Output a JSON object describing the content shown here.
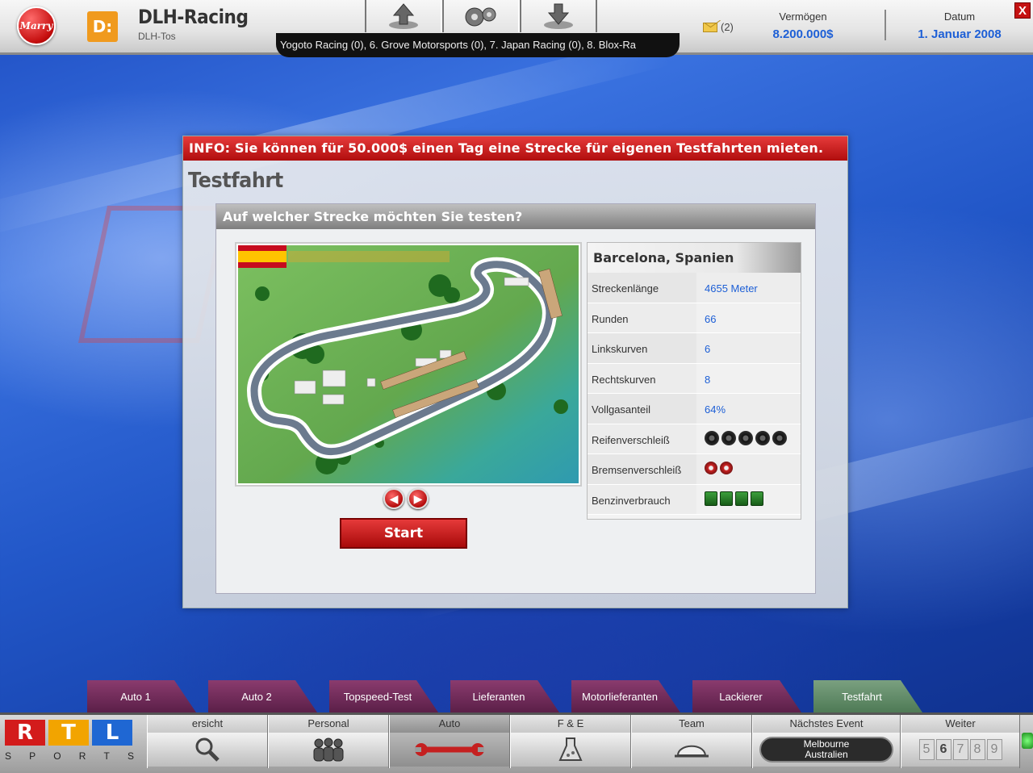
{
  "topbar": {
    "badge": "Marry",
    "team_logo": "D:",
    "team_name": "DLH-Racing",
    "team_owner": "DLH-Tos",
    "ticker": "Yogoto Racing (0),   6. Grove Motorsports (0),   7. Japan Racing (0),   8. Blox-Ra",
    "mail_count": "(2)",
    "vermoegen_label": "Vermögen",
    "vermoegen_value": "8.200.000$",
    "datum_label": "Datum",
    "datum_value": "1. Januar 2008",
    "close": "X"
  },
  "dialog": {
    "info": "INFO: Sie können für 50.000$ einen Tag eine Strecke für eigenen Testfahrten mieten.",
    "title": "Testfahrt",
    "panel_header": "Auf welcher Strecke möchten Sie testen?",
    "start_label": "Start",
    "track": {
      "name": "Barcelona, Spanien",
      "rows": [
        {
          "label": "Streckenlänge",
          "value": "4655 Meter"
        },
        {
          "label": "Runden",
          "value": "66"
        },
        {
          "label": "Linkskurven",
          "value": "6"
        },
        {
          "label": "Rechtskurven",
          "value": "8"
        },
        {
          "label": "Vollgasanteil",
          "value": "64%"
        },
        {
          "label": "Reifenverschleiß",
          "rating": 5
        },
        {
          "label": "Bremsenverschleiß",
          "rating": 2
        },
        {
          "label": "Benzinverbrauch",
          "rating": 4
        }
      ]
    }
  },
  "subtabs": [
    "Auto 1",
    "Auto 2",
    "Topspeed-Test",
    "Lieferanten",
    "Motorlieferanten",
    "Lackierer",
    "Testfahrt"
  ],
  "rtl": {
    "letters": [
      "R",
      "T",
      "L"
    ],
    "sports": [
      "S",
      "P",
      "O",
      "R",
      "T",
      "S"
    ]
  },
  "bottom_nav": {
    "uebersicht": "ersicht",
    "personal": "Personal",
    "auto": "Auto",
    "fe": "F & E",
    "team": "Team",
    "next_event_label": "Nächstes Event",
    "next_event_line1": "Melbourne",
    "next_event_line2": "Australien",
    "weiter": "Weiter",
    "digits": [
      "5",
      "6",
      "7",
      "8",
      "9"
    ]
  },
  "colors": {
    "accent_red": "#c51212",
    "link_blue": "#1d5fd6",
    "tab_purple": "#6e2c59",
    "tab_active_green": "#5f8e66"
  }
}
